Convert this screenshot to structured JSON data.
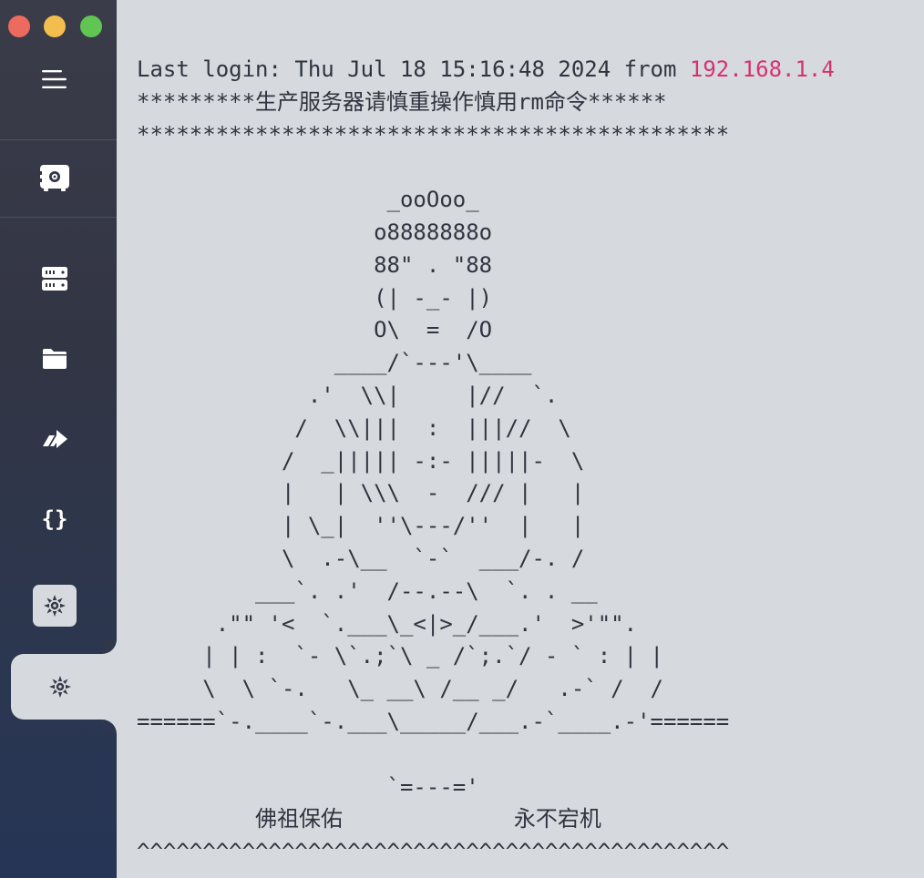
{
  "window": {
    "controls": [
      "close",
      "minimize",
      "zoom"
    ]
  },
  "sidebar": {
    "items": [
      {
        "icon": "menu-icon"
      },
      {
        "icon": "vault-icon"
      },
      {
        "icon": "hosts-icon"
      },
      {
        "icon": "sftp-folder-icon"
      },
      {
        "icon": "port-forwarding-icon"
      },
      {
        "icon": "snippets-icon"
      },
      {
        "icon": "host-tab-icon"
      },
      {
        "icon": "host-tab-active-icon"
      }
    ],
    "colors": {
      "background_top": "#3a3c49",
      "background_bottom": "#263556",
      "icon": "#ffffff",
      "active_tab": "#d6dade"
    }
  },
  "terminal": {
    "login_prefix": "Last login: Thu Jul 18 15:16:48 2024 from ",
    "login_ip": "192.168.1.4",
    "ip_color": "#d6336c",
    "banner_line": "*********生产服务器请慎重操作慎用rm命令******",
    "lines": [
      "*********************************************",
      "",
      "                   _ooOoo_",
      "                  o8888888o",
      "                  88\" . \"88",
      "                  (| -_- |)",
      "                  O\\  =  /O",
      "               ____/`---'\\____",
      "             .'  \\\\|     |//  `.",
      "            /  \\\\|||  :  |||//  \\",
      "           /  _||||| -:- |||||-  \\",
      "           |   | \\\\\\  -  /// |   |",
      "           | \\_|  ''\\---/''  |   |",
      "           \\  .-\\__  `-`  ___/-. /",
      "         ___`. .'  /--.--\\  `. . __",
      "      .\"\" '<  `.___\\_<|>_/___.'  >'\"\".",
      "     | | :  `- \\`.;`\\ _ /`;.`/ - ` : | |",
      "     \\  \\ `-.   \\_ __\\ /__ _/   .-` /  /",
      "======`-.____`-.___\\_____/___.-`____.-'======",
      "",
      "                   `=---='",
      "         佛祖保佑             永不宕机",
      "^^^^^^^^^^^^^^^^^^^^^^^^^^^^^^^^^^^^^^^^^^^^^"
    ],
    "text_color": "#2f3440",
    "background": "#d6dade"
  }
}
